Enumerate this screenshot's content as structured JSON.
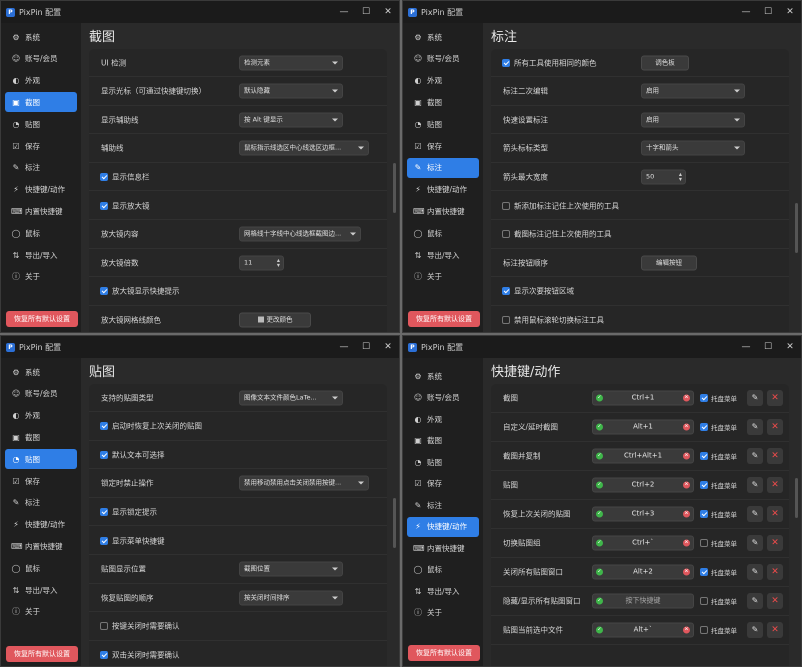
{
  "windows": [
    {
      "title": "PixPin 配置",
      "page_title": "截图",
      "reset_label": "恢复所有默认设置",
      "active": 3,
      "nav": [
        "系统",
        "账号/会员",
        "外观",
        "截图",
        "贴图",
        "保存",
        "标注",
        "快捷键/动作",
        "内置快捷键",
        "鼠标",
        "导出/导入",
        "关于"
      ],
      "rows": [
        {
          "type": "dd",
          "label": "UI 检测",
          "value": "检测元素",
          "dd_w": 104
        },
        {
          "type": "dd",
          "label": "显示光标（可通过快捷键切换）",
          "value": "默认隐藏",
          "dd_w": 104
        },
        {
          "type": "dd",
          "label": "显示辅助线",
          "value": "按 Alt 键显示",
          "dd_w": 104
        },
        {
          "type": "dd",
          "label": "辅助线",
          "value": "鼠标指示线选区中心线选区边框...",
          "dd_w": 130
        },
        {
          "type": "cb",
          "label": "显示信息栏",
          "on": true
        },
        {
          "type": "cb",
          "label": "显示放大镜",
          "on": true
        },
        {
          "type": "dd",
          "label": "放大镜内容",
          "value": "网格线十字线中心线选框截图边...",
          "dd_w": 122
        },
        {
          "type": "num",
          "label": "放大镜倍数",
          "value": "11"
        },
        {
          "type": "cb",
          "label": "放大镜显示快捷提示",
          "on": true
        },
        {
          "type": "btn",
          "label": "放大镜网格线颜色",
          "value": "更改颜色"
        }
      ]
    },
    {
      "title": "PixPin 配置",
      "page_title": "标注",
      "reset_label": "恢复所有默认设置",
      "active": 6,
      "nav": [
        "系统",
        "账号/会员",
        "外观",
        "截图",
        "贴图",
        "保存",
        "标注",
        "快捷键/动作",
        "内置快捷键",
        "鼠标",
        "导出/导入",
        "关于"
      ],
      "rows": [
        {
          "type": "cbx",
          "label": "所有工具使用相同的颜色",
          "on": true,
          "btn": "调色板"
        },
        {
          "type": "dd",
          "label": "标注二次编辑",
          "value": "启用",
          "dd_w": 104
        },
        {
          "type": "dd",
          "label": "快速设置标注",
          "value": "启用",
          "dd_w": 104
        },
        {
          "type": "dd",
          "label": "箭头标标类型",
          "value": "十字和箭头",
          "dd_w": 104
        },
        {
          "type": "num",
          "label": "箭头最大宽度",
          "value": "50"
        },
        {
          "type": "cb",
          "label": "新添加标注记住上次使用的工具",
          "on": false
        },
        {
          "type": "cb",
          "label": "截图标注记住上次使用的工具",
          "on": false
        },
        {
          "type": "btn",
          "label": "标注按钮顺序",
          "value": "编辑按钮"
        },
        {
          "type": "cb",
          "label": "显示次要按钮区域",
          "on": true
        },
        {
          "type": "cb",
          "label": "禁用鼠标滚轮切换标注工具",
          "on": false
        }
      ]
    },
    {
      "title": "PixPin 配置",
      "page_title": "贴图",
      "reset_label": "恢复所有默认设置",
      "active": 4,
      "nav": [
        "系统",
        "账号/会员",
        "外观",
        "截图",
        "贴图",
        "保存",
        "标注",
        "快捷键/动作",
        "内置快捷键",
        "鼠标",
        "导出/导入",
        "关于"
      ],
      "rows": [
        {
          "type": "dd",
          "label": "支持的贴图类型",
          "value": "图像文本文件颜色LaTe...",
          "dd_w": 104
        },
        {
          "type": "cb",
          "label": "启动时恢复上次关闭的贴图",
          "on": true
        },
        {
          "type": "cb",
          "label": "默认文本可选择",
          "on": true
        },
        {
          "type": "dd",
          "label": "锁定时禁止操作",
          "value": "禁用移动禁用点击关闭禁用按键...",
          "dd_w": 130
        },
        {
          "type": "cb",
          "label": "显示锁定提示",
          "on": true
        },
        {
          "type": "cb",
          "label": "显示菜单快捷键",
          "on": true
        },
        {
          "type": "dd",
          "label": "贴图显示位置",
          "value": "截图位置",
          "dd_w": 104
        },
        {
          "type": "dd",
          "label": "恢复贴图的顺序",
          "value": "按关闭时间排序",
          "dd_w": 104
        },
        {
          "type": "cb",
          "label": "按键关闭时需要确认",
          "on": false
        },
        {
          "type": "cb",
          "label": "双击关闭时需要确认",
          "on": true
        }
      ]
    },
    {
      "title": "PixPin 配置",
      "page_title": "快捷键/动作",
      "reset_label": "恢复所有默认设置",
      "active": 7,
      "nav": [
        "系统",
        "账号/会员",
        "外观",
        "截图",
        "贴图",
        "保存",
        "标注",
        "快捷键/动作",
        "内置快捷键",
        "鼠标",
        "导出/导入",
        "关于"
      ],
      "hk_check_label": "托盘菜单",
      "rows": [
        {
          "label": "截图",
          "key": "Ctrl+1",
          "tray": true,
          "ok": true
        },
        {
          "label": "自定义/延时截图",
          "key": "Alt+1",
          "tray": true,
          "ok": true
        },
        {
          "label": "截图并复制",
          "key": "Ctrl+Alt+1",
          "tray": true,
          "ok": true
        },
        {
          "label": "贴图",
          "key": "Ctrl+2",
          "tray": true,
          "ok": true
        },
        {
          "label": "恢复上次关闭的贴图",
          "key": "Ctrl+3",
          "tray": true,
          "ok": true
        },
        {
          "label": "切换贴图组",
          "key": "Ctrl+`",
          "tray": false,
          "ok": true
        },
        {
          "label": "关闭所有贴图窗口",
          "key": "Alt+2",
          "tray": true,
          "ok": true
        },
        {
          "label": "隐藏/显示所有贴图窗口",
          "key": "按下快捷键",
          "tray": false,
          "ok": false
        },
        {
          "label": "贴图当前选中文件",
          "key": "Alt+`",
          "tray": false,
          "ok": true
        }
      ]
    }
  ]
}
